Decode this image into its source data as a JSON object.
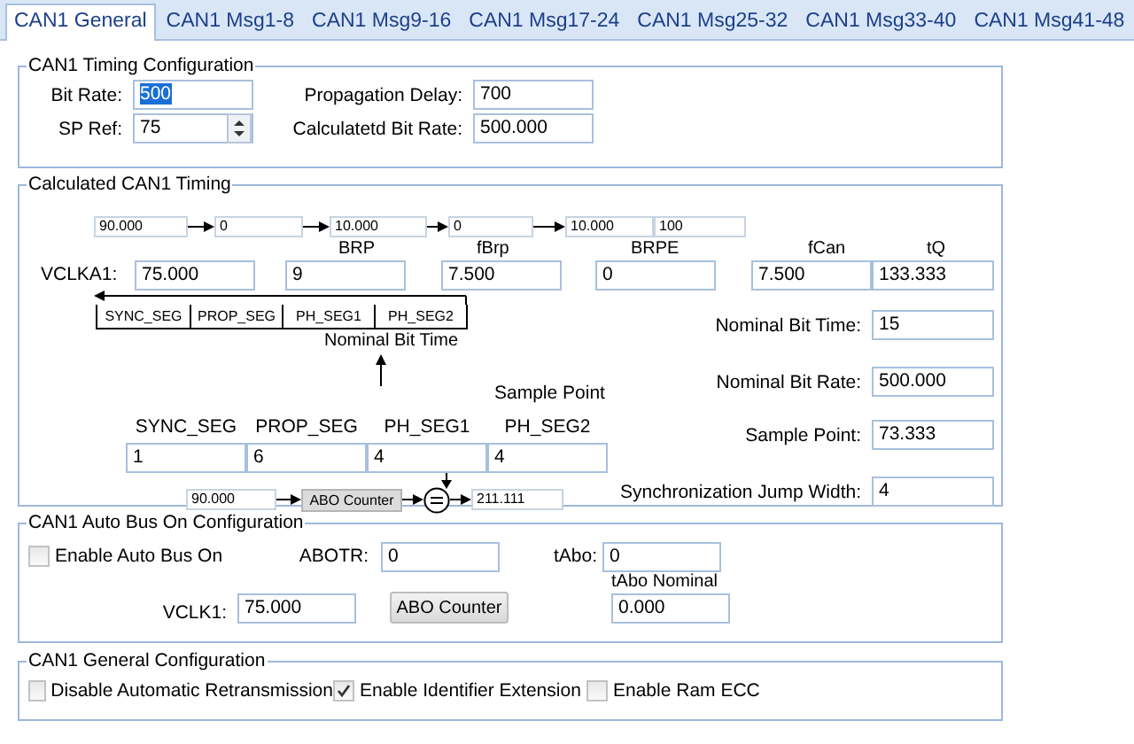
{
  "tabs": [
    {
      "label": "CAN1 General",
      "selected": true
    },
    {
      "label": "CAN1 Msg1-8",
      "selected": false
    },
    {
      "label": "CAN1 Msg9-16",
      "selected": false
    },
    {
      "label": "CAN1 Msg17-24",
      "selected": false
    },
    {
      "label": "CAN1 Msg25-32",
      "selected": false
    },
    {
      "label": "CAN1 Msg33-40",
      "selected": false
    },
    {
      "label": "CAN1 Msg41-48",
      "selected": false
    }
  ],
  "timing_config": {
    "title": "CAN1 Timing Configuration",
    "fields": [
      {
        "label": "Bit Rate:",
        "value": "500",
        "kind": "text",
        "text_highlighted": true
      },
      {
        "label": "Propagation Delay:",
        "value": "700",
        "kind": "text",
        "text_highlighted": false
      },
      {
        "label": "SP Ref:",
        "value": "75",
        "kind": "spin",
        "text_highlighted": false
      },
      {
        "label": "Calculatetd Bit Rate:",
        "value": "500.000",
        "kind": "text",
        "text_highlighted": false
      }
    ]
  },
  "calculated_timing": {
    "title": "Calculated CAN1 Timing",
    "prescaler_chain": [
      "90.000",
      "0",
      "10.000",
      "0",
      "10.000",
      "100"
    ],
    "chain_labels": [
      "BRP",
      "fBrp",
      "BRPE"
    ],
    "vclka1_label": "VCLKA1:",
    "row_values": [
      "75.000",
      "9",
      "7.500",
      "0"
    ],
    "fcan": {
      "label": "fCan",
      "value": "7.500"
    },
    "tq": {
      "label": "tQ",
      "value": "133.333"
    },
    "bit_segments": [
      "SYNC_SEG",
      "PROP_SEG",
      "PH_SEG1",
      "PH_SEG2"
    ],
    "nominal_bit_time_caption": "Nominal Bit Time",
    "results": [
      {
        "label": "Nominal Bit Time:",
        "value": "15"
      },
      {
        "label": "Nominal Bit Rate:",
        "value": "500.000"
      },
      {
        "label": "Sample Point:",
        "value": "73.333"
      },
      {
        "label": "Synchronization Jump Width:",
        "value": "4"
      }
    ],
    "sample_point_caption": "Sample Point",
    "segments": [
      {
        "label": "SYNC_SEG",
        "value": "1"
      },
      {
        "label": "PROP_SEG",
        "value": "6"
      },
      {
        "label": "PH_SEG1",
        "value": "4"
      },
      {
        "label": "PH_SEG2",
        "value": "4"
      }
    ],
    "abo_chain": {
      "input": "90.000",
      "block": "ABO Counter",
      "output": "211.111"
    }
  },
  "auto_bus_on": {
    "title": "CAN1 Auto Bus On Configuration",
    "enable": {
      "label": "Enable Auto Bus On",
      "checked": false
    },
    "abotr": {
      "label": "ABOTR:",
      "value": "0"
    },
    "tabo": {
      "label": "tAbo:",
      "value": "0"
    },
    "vclk1": {
      "label": "VCLK1:",
      "value": "75.000"
    },
    "button": "ABO Counter",
    "tabo_nominal": {
      "label": "tAbo Nominal",
      "value": "0.000"
    }
  },
  "general": {
    "title": "CAN1 General Configuration",
    "options": [
      {
        "label": "Disable Automatic Retransmission",
        "checked": false
      },
      {
        "label": "Enable Identifier Extension",
        "checked": true
      },
      {
        "label": "Enable Ram ECC",
        "checked": false
      }
    ]
  }
}
